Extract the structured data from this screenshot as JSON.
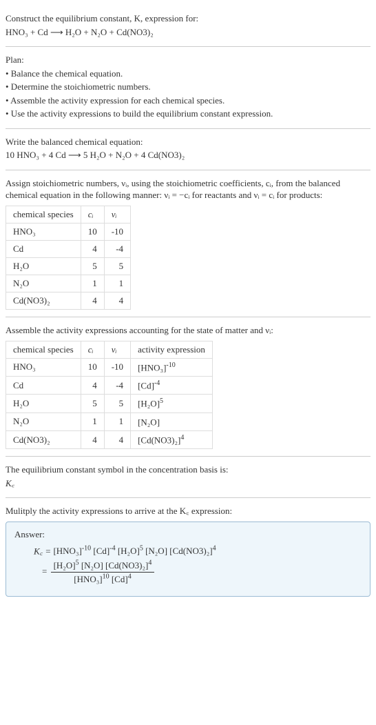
{
  "intro": {
    "line1": "Construct the equilibrium constant, K, expression for:",
    "reaction": "HNO₃ + Cd ⟶ H₂O + N₂O + Cd(NO3)₂"
  },
  "plan": {
    "heading": "Plan:",
    "items": [
      "• Balance the chemical equation.",
      "• Determine the stoichiometric numbers.",
      "• Assemble the activity expression for each chemical species.",
      "• Use the activity expressions to build the equilibrium constant expression."
    ]
  },
  "balanced": {
    "heading": "Write the balanced chemical equation:",
    "equation": "10 HNO₃ + 4 Cd ⟶ 5 H₂O + N₂O + 4 Cd(NO3)₂"
  },
  "stoich": {
    "heading_a": "Assign stoichiometric numbers, νᵢ, using the stoichiometric coefficients, cᵢ, from the balanced chemical equation in the following manner: νᵢ = −cᵢ for reactants and νᵢ = cᵢ for products:",
    "cols": [
      "chemical species",
      "cᵢ",
      "νᵢ"
    ],
    "rows": [
      {
        "sp": "HNO₃",
        "c": "10",
        "v": "-10"
      },
      {
        "sp": "Cd",
        "c": "4",
        "v": "-4"
      },
      {
        "sp": "H₂O",
        "c": "5",
        "v": "5"
      },
      {
        "sp": "N₂O",
        "c": "1",
        "v": "1"
      },
      {
        "sp": "Cd(NO3)₂",
        "c": "4",
        "v": "4"
      }
    ]
  },
  "activity": {
    "heading": "Assemble the activity expressions accounting for the state of matter and νᵢ:",
    "cols": [
      "chemical species",
      "cᵢ",
      "νᵢ",
      "activity expression"
    ],
    "rows": [
      {
        "sp": "HNO₃",
        "c": "10",
        "v": "-10",
        "ae_base": "[HNO₃]",
        "ae_exp": "-10"
      },
      {
        "sp": "Cd",
        "c": "4",
        "v": "-4",
        "ae_base": "[Cd]",
        "ae_exp": "-4"
      },
      {
        "sp": "H₂O",
        "c": "5",
        "v": "5",
        "ae_base": "[H₂O]",
        "ae_exp": "5"
      },
      {
        "sp": "N₂O",
        "c": "1",
        "v": "1",
        "ae_base": "[N₂O]",
        "ae_exp": ""
      },
      {
        "sp": "Cd(NO3)₂",
        "c": "4",
        "v": "4",
        "ae_base": "[Cd(NO3)₂]",
        "ae_exp": "4"
      }
    ]
  },
  "kc_symbol": {
    "line1": "The equilibrium constant symbol in the concentration basis is:",
    "symbol": "K꜀"
  },
  "multiply": {
    "heading": "Mulitply the activity expressions to arrive at the K꜀ expression:"
  },
  "answer": {
    "label": "Answer:",
    "line1_prefix": "K꜀ = ",
    "line1_terms": [
      {
        "base": "[HNO₃]",
        "exp": "-10"
      },
      {
        "base": "[Cd]",
        "exp": "-4"
      },
      {
        "base": "[H₂O]",
        "exp": "5"
      },
      {
        "base": "[N₂O]",
        "exp": ""
      },
      {
        "base": "[Cd(NO3)₂]",
        "exp": "4"
      }
    ],
    "line2_prefix": "= ",
    "frac_num": [
      {
        "base": "[H₂O]",
        "exp": "5"
      },
      {
        "base": "[N₂O]",
        "exp": ""
      },
      {
        "base": "[Cd(NO3)₂]",
        "exp": "4"
      }
    ],
    "frac_den": [
      {
        "base": "[HNO₃]",
        "exp": "10"
      },
      {
        "base": "[Cd]",
        "exp": "4"
      }
    ]
  },
  "chart_data": {
    "type": "table",
    "tables": [
      {
        "title": "Stoichiometric numbers",
        "columns": [
          "chemical species",
          "c_i",
          "ν_i"
        ],
        "rows": [
          [
            "HNO3",
            10,
            -10
          ],
          [
            "Cd",
            4,
            -4
          ],
          [
            "H2O",
            5,
            5
          ],
          [
            "N2O",
            1,
            1
          ],
          [
            "Cd(NO3)2",
            4,
            4
          ]
        ]
      },
      {
        "title": "Activity expressions",
        "columns": [
          "chemical species",
          "c_i",
          "ν_i",
          "activity expression"
        ],
        "rows": [
          [
            "HNO3",
            10,
            -10,
            "[HNO3]^-10"
          ],
          [
            "Cd",
            4,
            -4,
            "[Cd]^-4"
          ],
          [
            "H2O",
            5,
            5,
            "[H2O]^5"
          ],
          [
            "N2O",
            1,
            1,
            "[N2O]"
          ],
          [
            "Cd(NO3)2",
            4,
            4,
            "[Cd(NO3)2]^4"
          ]
        ]
      }
    ]
  }
}
